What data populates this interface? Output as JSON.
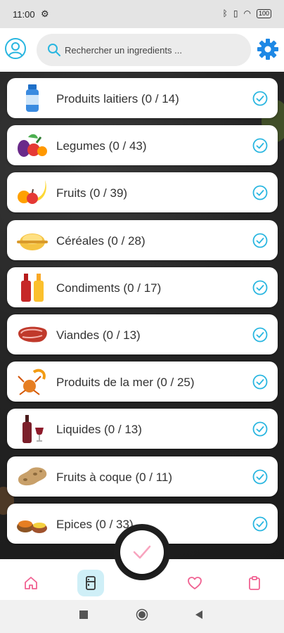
{
  "status_bar": {
    "time": "11:00",
    "battery": "100"
  },
  "search": {
    "placeholder": "Rechercher un ingredients ..."
  },
  "colors": {
    "accent": "#1e88e5",
    "check": "#29b6e0",
    "nav_pink": "#f06292",
    "fab_check": "#f8a4be"
  },
  "categories": [
    {
      "label": "Produits laitiers (0 / 14)",
      "icon": "milk-bottle-icon"
    },
    {
      "label": "Legumes (0 / 43)",
      "icon": "vegetables-icon"
    },
    {
      "label": "Fruits (0 / 39)",
      "icon": "fruits-icon"
    },
    {
      "label": "Céréales (0 / 28)",
      "icon": "cereals-icon"
    },
    {
      "label": "Condiments (0 / 17)",
      "icon": "condiments-icon"
    },
    {
      "label": "Viandes (0 / 13)",
      "icon": "meat-icon"
    },
    {
      "label": "Produits de la mer (0 / 25)",
      "icon": "seafood-icon"
    },
    {
      "label": "Liquides (0 / 13)",
      "icon": "wine-icon"
    },
    {
      "label": "Fruits à coque (0 / 11)",
      "icon": "nuts-icon"
    },
    {
      "label": "Epices (0 / 33)",
      "icon": "spices-icon"
    }
  ],
  "bottom_nav": [
    "home-icon",
    "fridge-icon",
    "heart-icon",
    "clipboard-icon"
  ]
}
